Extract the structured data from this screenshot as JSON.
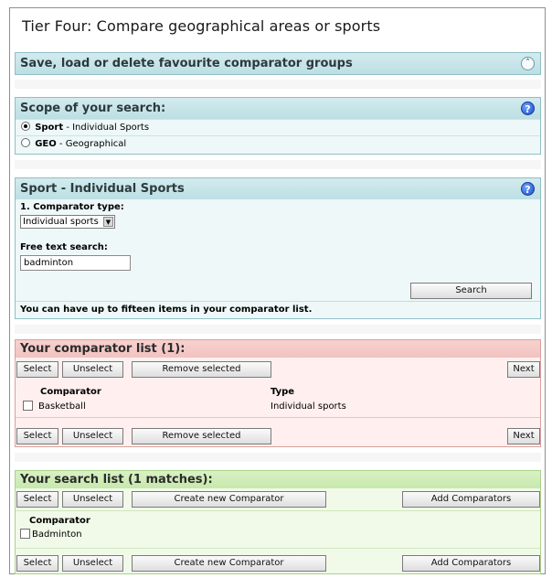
{
  "page": {
    "title": "Tier Four: Compare geographical areas or sports"
  },
  "favourites": {
    "heading": "Save, load or delete favourite comparator groups",
    "icon": "collapse-icon"
  },
  "scope": {
    "heading": "Scope of your search:",
    "options": [
      {
        "bold": "Sport",
        "label": " - Individual Sports",
        "checked": true
      },
      {
        "bold": "GEO",
        "label": " - Geographical",
        "checked": false
      }
    ]
  },
  "sport_panel": {
    "heading": "Sport - Individual Sports",
    "comparator_type_label": "1. Comparator type:",
    "comparator_type_value": "Individual sports",
    "free_text_label": "Free text search:",
    "free_text_value": "badminton",
    "search_button": "Search",
    "note": "You can have up to fifteen items in your comparator list."
  },
  "comparator_list": {
    "heading": "Your comparator list (1):",
    "buttons": {
      "select": "Select",
      "unselect": "Unselect",
      "remove": "Remove selected",
      "next": "Next"
    },
    "columns": [
      "Comparator",
      "Type"
    ],
    "rows": [
      {
        "name": "Basketball",
        "type": "Individual sports"
      }
    ]
  },
  "search_list": {
    "heading": "Your search list (1 matches):",
    "buttons": {
      "select": "Select",
      "unselect": "Unselect",
      "create": "Create new Comparator",
      "add": "Add Comparators"
    },
    "columns": [
      "Comparator"
    ],
    "rows": [
      {
        "name": "Badminton"
      }
    ]
  },
  "colors": {
    "teal_header": "#c6e5e9",
    "pink_header": "#f4c8c5",
    "green_header": "#cdebb4",
    "help_icon": "#2a5fd8"
  }
}
